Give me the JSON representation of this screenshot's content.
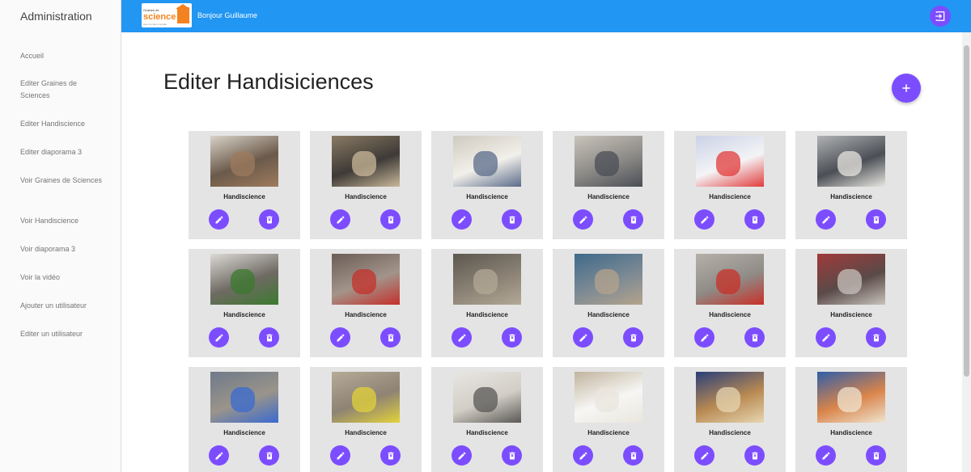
{
  "sidebar": {
    "title": "Administration",
    "items": [
      {
        "label": "Accueil"
      },
      {
        "label": "Editer Graines de Sciences"
      },
      {
        "label": "Editer Handiscience"
      },
      {
        "label": "Editer diaporama 3"
      },
      {
        "label": "Voir Graines de Sciences"
      },
      {
        "label": "Voir Handiscience"
      },
      {
        "label": "Voir diaporama 3"
      },
      {
        "label": "Voir la vidéo"
      },
      {
        "label": "Ajouter un utilisateur"
      },
      {
        "label": "Editer un utilisateur"
      }
    ]
  },
  "header": {
    "logo": {
      "top_text": "Graines de",
      "word": "science",
      "bottom_text": "avec la main à la pâte"
    },
    "greeting": "Bonjour Guillaume",
    "logout_icon": "logout-icon"
  },
  "main": {
    "title": "Editer Handisiciences",
    "add_icon": "plus-icon"
  },
  "cards": [
    {
      "label": "Handiscience",
      "photo": "children-on-floor"
    },
    {
      "label": "Handiscience",
      "photo": "girl-with-sign"
    },
    {
      "label": "Handiscience",
      "photo": "handwritten-poster"
    },
    {
      "label": "Handiscience",
      "photo": "group-on-floor"
    },
    {
      "label": "Handiscience",
      "photo": "slide-with-icons"
    },
    {
      "label": "Handiscience",
      "photo": "kids-with-board"
    },
    {
      "label": "Handiscience",
      "photo": "sign-close-up"
    },
    {
      "label": "Handiscience",
      "photo": "kids-in-hallway"
    },
    {
      "label": "Handiscience",
      "photo": "kids-outdoors"
    },
    {
      "label": "Handiscience",
      "photo": "kids-in-courtyard"
    },
    {
      "label": "Handiscience",
      "photo": "boy-crouching"
    },
    {
      "label": "Handiscience",
      "photo": "kids-by-wall"
    },
    {
      "label": "Handiscience",
      "photo": "kids-in-gym"
    },
    {
      "label": "Handiscience",
      "photo": "kid-jumping-in-gym"
    },
    {
      "label": "Handiscience",
      "photo": "open-booklet"
    },
    {
      "label": "Handiscience",
      "photo": "paper-sheet"
    },
    {
      "label": "Handiscience",
      "photo": "boy-at-table"
    },
    {
      "label": "Handiscience",
      "photo": "kids-at-desk"
    }
  ],
  "actions": {
    "edit_icon": "pencil-icon",
    "delete_icon": "trash-icon"
  },
  "colors": {
    "header": "#2196f3",
    "accent": "#7c4dff",
    "card": "#e4e4e4",
    "sidebar": "#fafafa"
  }
}
